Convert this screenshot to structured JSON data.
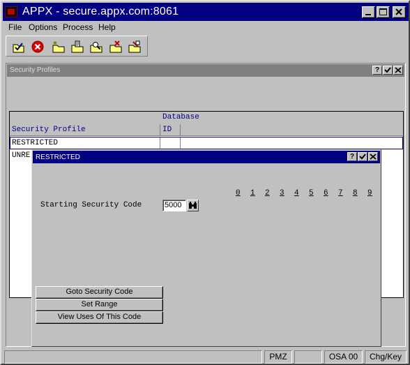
{
  "app": {
    "title": "APPX - secure.appx.com:8061"
  },
  "menu": [
    {
      "label": "File"
    },
    {
      "label": "Options"
    },
    {
      "label": "Process"
    },
    {
      "label": "Help"
    }
  ],
  "toolbar_icons": [
    "check-folder-icon",
    "cancel-icon",
    "new-folder-icon",
    "edit-folder-icon",
    "search-folder-icon",
    "delete-folder-icon",
    "clear-folder-icon"
  ],
  "security_window": {
    "title": "Security Profiles",
    "table": {
      "header_top": "Database",
      "col1": "Security Profile",
      "col2": "ID",
      "rows": [
        {
          "profile": "RESTRICTED",
          "id": ""
        },
        {
          "profile": "UNRE",
          "id": ""
        }
      ]
    }
  },
  "dialog": {
    "title": "RESTRICTED",
    "digits": [
      "0",
      "1",
      "2",
      "3",
      "4",
      "5",
      "6",
      "7",
      "8",
      "9"
    ],
    "field_label": "Starting Security Code",
    "field_value": "5000",
    "buttons": [
      {
        "label": "Goto Security Code"
      },
      {
        "label": "Set Range"
      },
      {
        "label": "View Uses Of This Code"
      }
    ]
  },
  "status": {
    "cells": [
      "",
      "PMZ",
      "",
      "OSA 00",
      "Chg/Key"
    ]
  },
  "colors": {
    "titlebar": "#000080",
    "face": "#c0c0c0",
    "header_text": "#000080"
  }
}
